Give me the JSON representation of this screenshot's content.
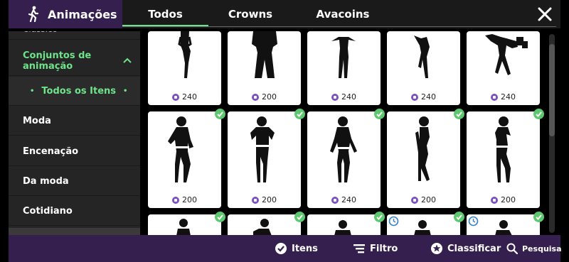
{
  "header": {
    "section_title": "Animações",
    "tabs": [
      {
        "label": "Todos",
        "active": true
      },
      {
        "label": "Crowns",
        "active": false
      },
      {
        "label": "Avacoins",
        "active": false
      }
    ]
  },
  "sidebar": {
    "partial_item": "Clássico",
    "group": "Conjuntos de animação",
    "sub_item": "Todos os Itens",
    "items": [
      "Moda",
      "Encenação",
      "Da moda",
      "Cotidiano"
    ]
  },
  "grid": {
    "row1": [
      "240",
      "200",
      "240",
      "240",
      "240"
    ],
    "row2": [
      "200",
      "200",
      "240",
      "200",
      "200"
    ]
  },
  "bottom": {
    "items_label": "Itens",
    "filter_label": "Filtro",
    "sort_label": "Classificar",
    "search_label": "Pesquisa"
  },
  "colors": {
    "accent_green": "#6ee38a",
    "bar_purple": "#351f4f",
    "coin_purple": "#7e4fbf"
  }
}
